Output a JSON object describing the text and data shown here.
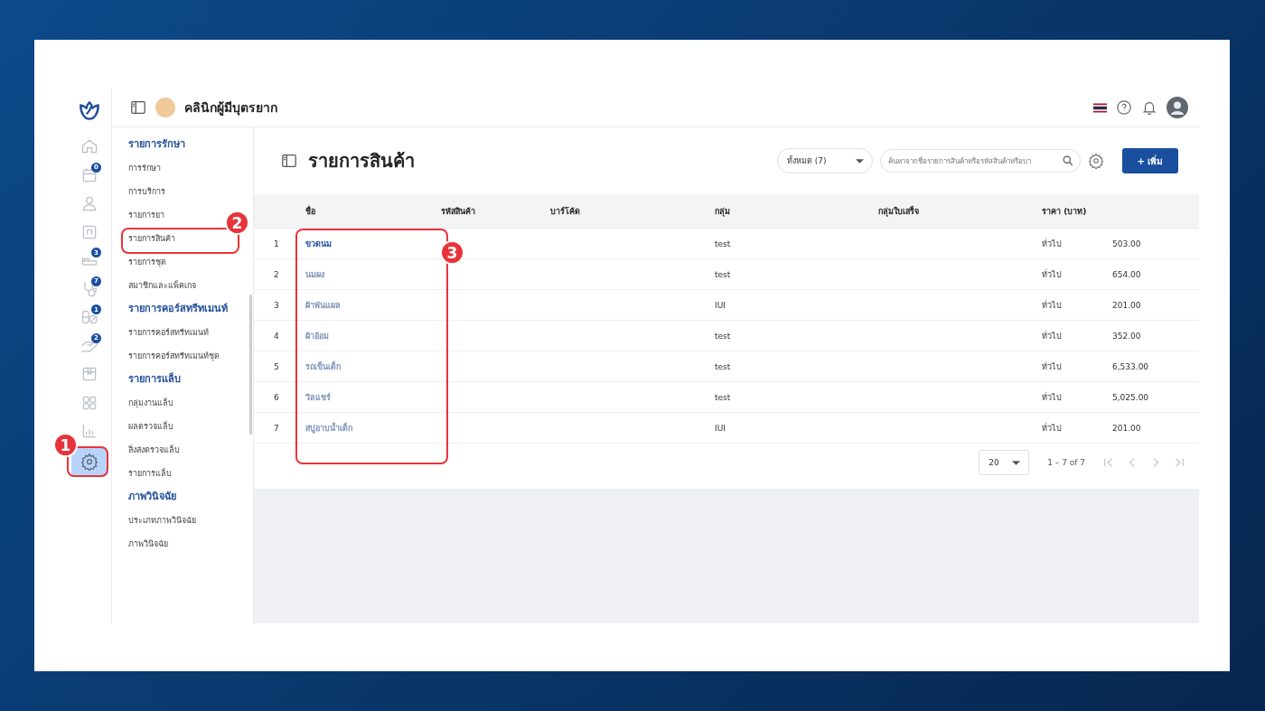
{
  "rail": {
    "items": [
      {
        "kind": "home",
        "selected": false
      },
      {
        "kind": "calendar",
        "badge": "0",
        "selected": false
      },
      {
        "kind": "person",
        "selected": false
      },
      {
        "kind": "frame",
        "selected": false
      },
      {
        "kind": "bed",
        "badge": "3",
        "selected": false
      },
      {
        "kind": "stethoscope",
        "badge": "7",
        "selected": false
      },
      {
        "kind": "pills",
        "badge": "1",
        "selected": false
      },
      {
        "kind": "hand",
        "badge": "2",
        "selected": false
      },
      {
        "kind": "box",
        "selected": false
      },
      {
        "kind": "grid",
        "selected": false
      },
      {
        "kind": "chart",
        "selected": false
      },
      {
        "kind": "gear",
        "selected": true
      }
    ]
  },
  "topbar": {
    "clinic_name": "คลินิกผู้มีบุตรยาก"
  },
  "submenu": [
    {
      "title": "รายการรักษา",
      "items": [
        "การรักษา",
        "การบริการ",
        "รายการยา",
        "รายการสินค้า",
        "รายการชุด",
        "สมาชิกและแพ็คเกจ"
      ]
    },
    {
      "title": "รายการคอร์สทรีทเมนท์",
      "items": [
        "รายการคอร์สทรีทเมนท์",
        "รายการคอร์สทรีทเมนท์ชุด"
      ]
    },
    {
      "title": "รายการแล็บ",
      "items": [
        "กลุ่มงานแล็บ",
        "ผลตรวจแล็บ",
        "สิ่งส่งตรวจแล็บ",
        "รายการแล็บ"
      ]
    },
    {
      "title": "ภาพวินิจฉัย",
      "items": [
        "ประเภทภาพวินิจฉัย",
        "ภาพวินิจฉัย"
      ]
    }
  ],
  "page": {
    "title": "รายการสินค้า",
    "filter": "ทั้งหมด (7)",
    "search": {
      "placeholder": "ค้นหาจากชื่อรายการสินค้าหรือรหัสสินค้าหรือบา"
    },
    "add_button": "+ เพิ่ม"
  },
  "table": {
    "columns": [
      "ชื่อ",
      "รหัสสินค้า",
      "บาร์โค้ด",
      "กลุ่ม",
      "กลุ่มใบเสร็จ",
      "ราคา (บาท)"
    ],
    "rows": [
      {
        "index": "1",
        "name": "ขวดนม",
        "group": "test",
        "price_type": "ทั่วไป",
        "price": "503.00",
        "blurred": false
      },
      {
        "index": "2",
        "name": "นมผง",
        "group": "test",
        "price_type": "ทั่วไป",
        "price": "654.00",
        "blurred": true
      },
      {
        "index": "3",
        "name": "ผ้าพันแผล",
        "group": "IUI",
        "price_type": "ทั่วไป",
        "price": "201.00",
        "blurred": true
      },
      {
        "index": "4",
        "name": "ผ้าอ้อม",
        "group": "test",
        "price_type": "ทั่วไป",
        "price": "352.00",
        "blurred": true
      },
      {
        "index": "5",
        "name": "รถเข็นเด็ก",
        "group": "test",
        "price_type": "ทั่วไป",
        "price": "6,533.00",
        "blurred": true
      },
      {
        "index": "6",
        "name": "วีลแชร์",
        "group": "test",
        "price_type": "ทั่วไป",
        "price": "5,025.00",
        "blurred": true
      },
      {
        "index": "7",
        "name": "สบู่อาบน้ำเด็ก",
        "group": "IUI",
        "price_type": "ทั่วไป",
        "price": "201.00",
        "blurred": true
      }
    ]
  },
  "pagination": {
    "page_size": "20",
    "range": "1 – 7 of 7"
  },
  "callouts": [
    {
      "number": "1"
    },
    {
      "number": "2"
    },
    {
      "number": "3"
    }
  ]
}
